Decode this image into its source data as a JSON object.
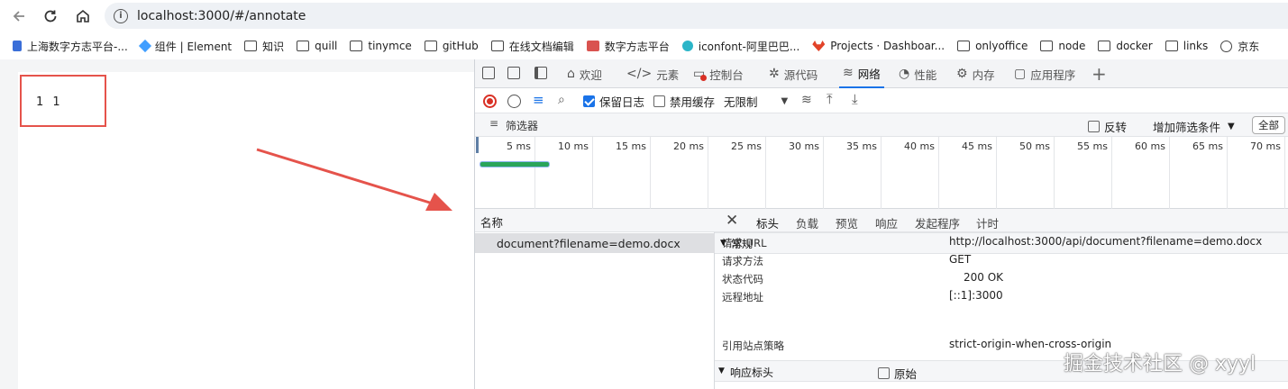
{
  "browser": {
    "url": "localhost:3000/#/annotate",
    "bookmarks": [
      "上海数字方志平台-...",
      "组件 | Element",
      "知识",
      "quill",
      "tinymce",
      "gitHub",
      "在线文档编辑",
      "数字方志平台",
      "iconfont-阿里巴巴...",
      "Projects · Dashboar...",
      "onlyoffice",
      "node",
      "docker",
      "links",
      "京东"
    ]
  },
  "page": {
    "annotation_text": "1 1"
  },
  "devtools": {
    "tabs": [
      "欢迎",
      "元素",
      "控制台",
      "源代码",
      "网络",
      "性能",
      "内存",
      "应用程序"
    ],
    "active_tab": "网络",
    "toolbar": {
      "preserve_log": "保留日志",
      "disable_cache": "禁用缓存",
      "throttle": "无限制"
    },
    "filter": {
      "placeholder": "筛选器",
      "invert": "反转",
      "more_filters": "增加筛选条件",
      "all": "全部"
    },
    "timeline_ticks": [
      "5 ms",
      "10 ms",
      "15 ms",
      "20 ms",
      "25 ms",
      "30 ms",
      "35 ms",
      "40 ms",
      "45 ms",
      "50 ms",
      "55 ms",
      "60 ms",
      "65 ms",
      "70 ms"
    ],
    "list_header": "名称",
    "requests": [
      "document?filename=demo.docx"
    ],
    "detail_tabs": [
      "标头",
      "负载",
      "预览",
      "响应",
      "发起程序",
      "计时"
    ],
    "general_title": "常规",
    "general": [
      {
        "k": "请求 URL",
        "v": "http://localhost:3000/api/document?filename=demo.docx"
      },
      {
        "k": "请求方法",
        "v": "GET"
      },
      {
        "k": "状态代码",
        "v": "200 OK"
      },
      {
        "k": "远程地址",
        "v": "[::1]:3000"
      },
      {
        "k": "引用站点策略",
        "v": "strict-origin-when-cross-origin"
      }
    ],
    "response_headers_title": "响应标头",
    "raw": "原始",
    "status_color": "#1e9e4a"
  },
  "watermark": "掘金技术社区 @ xyyl"
}
